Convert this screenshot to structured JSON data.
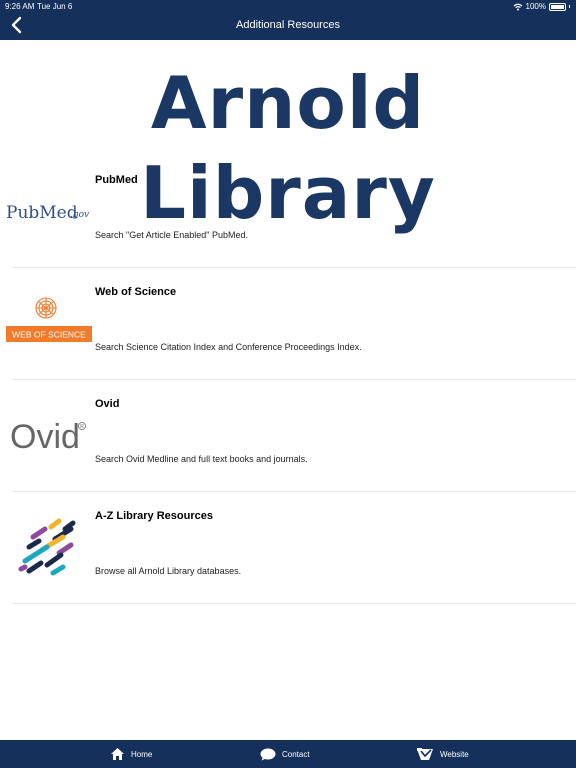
{
  "status_bar": {
    "time": "9:26 AM",
    "date": "Tue Jun 6",
    "battery": "100%"
  },
  "nav": {
    "title": "Additional Resources",
    "back_icon": "chevron-left-icon"
  },
  "banner": {
    "text": "Arnold Library"
  },
  "resources": [
    {
      "title": "PubMed",
      "description": "Search \"Get Article Enabled\" PubMed.",
      "logo": "pubmed-logo",
      "logo_text_main": "PubMed",
      "logo_text_suffix": ".gov"
    },
    {
      "title": "Web of Science",
      "description": "Search Science Citation Index and Conference Proceedings Index.",
      "logo": "web-of-science-logo",
      "logo_text_main": "WEB OF SCIENCE"
    },
    {
      "title": "Ovid",
      "description": "Search Ovid Medline and full text books and journals.",
      "logo": "ovid-logo",
      "logo_text_main": "Ovid"
    },
    {
      "title": "A-Z Library Resources",
      "description": "Browse all Arnold Library databases.",
      "logo": "a-z-resources-icon"
    }
  ],
  "tabs": [
    {
      "label": "Home",
      "icon": "home-icon"
    },
    {
      "label": "Contact",
      "icon": "chat-bubble-icon"
    },
    {
      "label": "Website",
      "icon": "website-icon"
    }
  ],
  "colors": {
    "navy": "#15305a",
    "banner_text": "#1b3764",
    "wos_orange": "#f07b2c",
    "pubmed_blue": "#2e4f8c"
  }
}
